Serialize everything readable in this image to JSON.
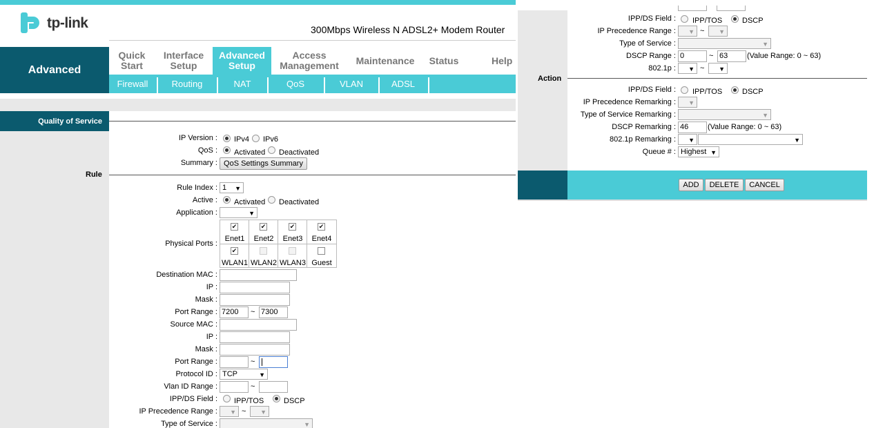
{
  "brand": {
    "name": "tp-link",
    "product": "300Mbps Wireless N ADSL2+ Modem Router"
  },
  "side_title": "Advanced",
  "nav": {
    "items": [
      {
        "l1": "Quick",
        "l2": "Start"
      },
      {
        "l1": "Interface",
        "l2": "Setup"
      },
      {
        "l1": "Advanced",
        "l2": "Setup"
      },
      {
        "l1": "Access",
        "l2": "Management"
      },
      {
        "l1": "Maintenance",
        "l2": ""
      },
      {
        "l1": "Status",
        "l2": ""
      },
      {
        "l1": "Help",
        "l2": ""
      }
    ]
  },
  "subnav": [
    "Firewall",
    "Routing",
    "NAT",
    "QoS",
    "VLAN",
    "ADSL"
  ],
  "section": {
    "title": "Quality of Service",
    "rule": "Rule",
    "action": "Action"
  },
  "qos": {
    "ip_version_label": "IP Version :",
    "ipv4": "IPv4",
    "ipv6": "IPv6",
    "qos_label": "QoS :",
    "activated": "Activated",
    "deactivated": "Deactivated",
    "summary_label": "Summary :",
    "summary_button": "QoS Settings Summary"
  },
  "rule": {
    "rule_index_label": "Rule Index :",
    "rule_index": "1",
    "active_label": "Active :",
    "activated": "Activated",
    "deactivated": "Deactivated",
    "application_label": "Application :",
    "physical_ports_label": "Physical Ports :",
    "ports_row1": [
      "Enet1",
      "Enet2",
      "Enet3",
      "Enet4"
    ],
    "ports_row2": [
      "WLAN1",
      "WLAN2",
      "WLAN3",
      "Guest"
    ],
    "dest_mac_label": "Destination MAC :",
    "ip_label": "IP :",
    "mask_label": "Mask :",
    "port_range_label": "Port Range :",
    "dest_port_from": "7200",
    "dest_port_to": "7300",
    "source_mac_label": "Source MAC :",
    "protocol_label": "Protocol ID :",
    "protocol": "TCP",
    "vlan_label": "Vlan ID Range :",
    "ippds_label": "IPP/DS Field :",
    "ipp_tos": "IPP/TOS",
    "dscp": "DSCP",
    "ip_prec_label": "IP Precedence Range :",
    "tos_label": "Type of Service :",
    "tilde": "~"
  },
  "right": {
    "ippds_label": "IPP/DS Field :",
    "ipp_tos": "IPP/TOS",
    "dscp": "DSCP",
    "ip_prec_label": "IP Precedence Range :",
    "tos_label": "Type of Service :",
    "dscp_range_label": "DSCP Range :",
    "dscp_from": "0",
    "dscp_to": "63",
    "value_range": "(Value Range: 0 ~ 63)",
    "p8021_label": "802.1p :",
    "tilde": "~"
  },
  "action": {
    "ippds_label": "IPP/DS Field :",
    "ipp_tos": "IPP/TOS",
    "dscp": "DSCP",
    "ip_prec_remark_label": "IP Precedence Remarking :",
    "tos_remark_label": "Type of Service Remarking :",
    "dscp_remark_label": "DSCP Remarking :",
    "dscp_remark": "46",
    "value_range": "(Value Range: 0 ~ 63)",
    "p8021_remark_label": "802.1p Remarking :",
    "queue_label": "Queue # :",
    "queue": "Highest"
  },
  "buttons": {
    "add": "ADD",
    "delete": "DELETE",
    "cancel": "CANCEL"
  },
  "colors": {
    "accent": "#4acbd6",
    "dark": "#0b5a6e",
    "panel": "#e8e8e8"
  }
}
